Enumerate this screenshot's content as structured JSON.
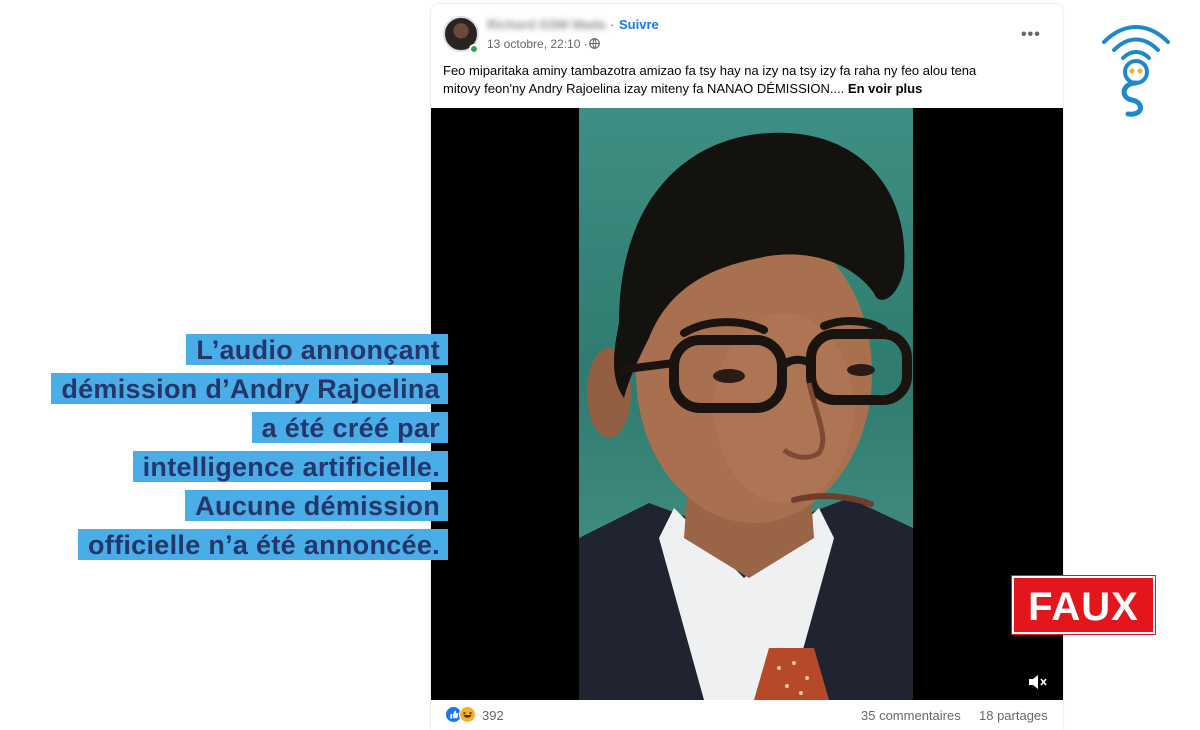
{
  "post": {
    "author_name": "Richard GSM Mada",
    "separator": "·",
    "follow_label": "Suivre",
    "date": "13 octobre, 22:10 ·",
    "more_label": "•••",
    "text_line1": "Feo miparitaka aminy tambazotra amizao fa tsy hay na izy na tsy izy fa raha ny feo alou tena",
    "text_line2": "mitovy feon'ny Andry Rajoelina izay miteny fa NANAO DÉMISSION....",
    "see_more": "En voir plus",
    "reaction_count": "392",
    "comments": "35 commentaires",
    "shares": "18 partages"
  },
  "caption": {
    "lines": [
      "L’audio annonçant",
      "démission d’Andry Rajoelina",
      "a été créé par",
      "intelligence artificielle.",
      "Aucune démission",
      "officielle n’a été annoncée."
    ]
  },
  "verdict": {
    "label": "FAUX"
  },
  "colors": {
    "caption_bg": "#49aee8",
    "caption_text": "#26356a",
    "verdict_bg": "#e3171b",
    "link": "#1877f2",
    "logo": "#1e88c8"
  },
  "icons": {
    "globe": "globe-icon",
    "more": "more-options-icon",
    "mute": "speaker-muted-icon",
    "like": "like-reaction-icon",
    "haha": "haha-reaction-icon"
  }
}
